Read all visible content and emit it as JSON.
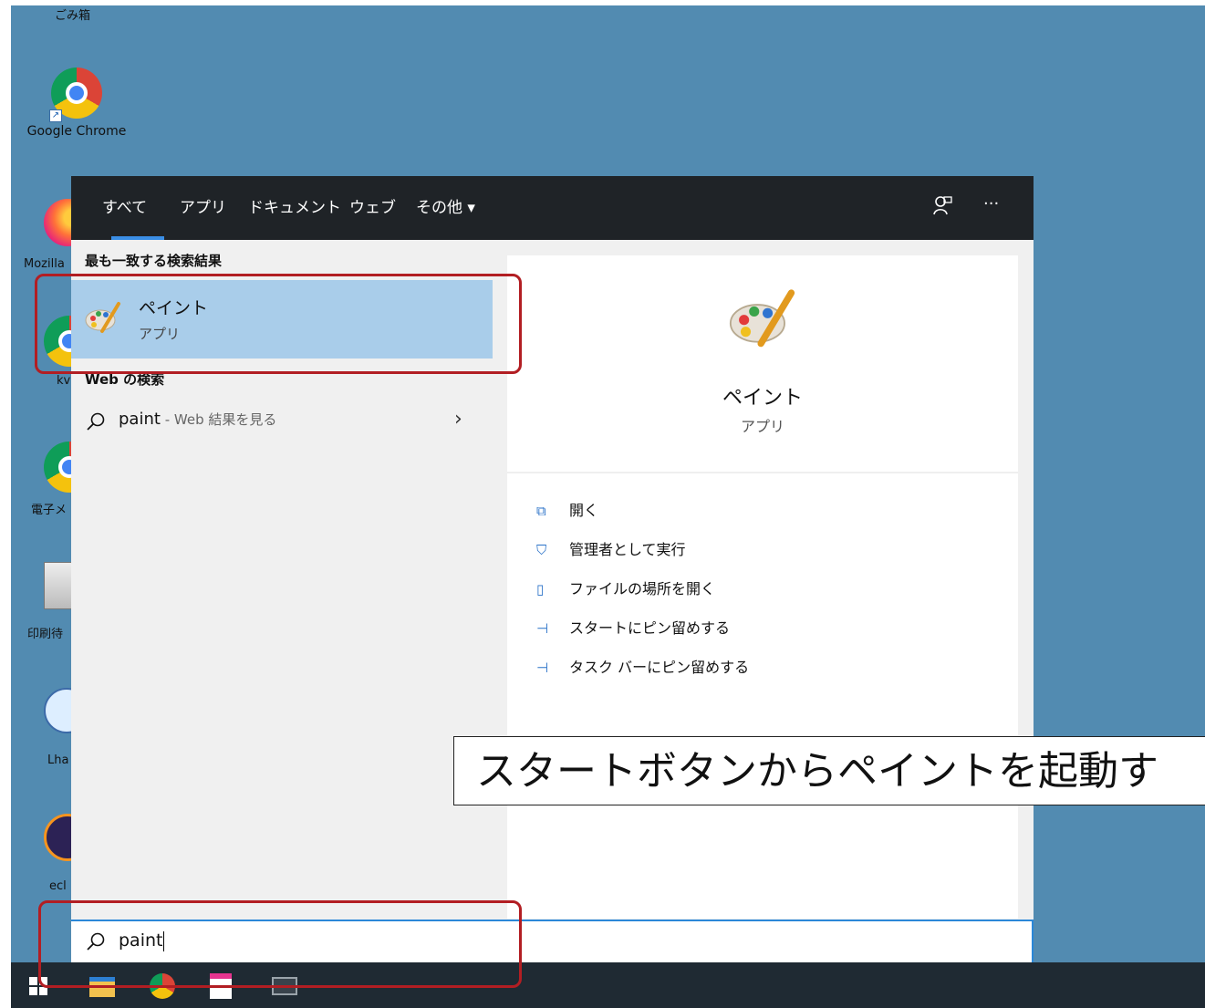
{
  "desktop": {
    "icons": [
      {
        "label": "ごみ箱"
      },
      {
        "label": "Google Chrome"
      },
      {
        "label": "Mozilla"
      },
      {
        "label": "kv"
      },
      {
        "label": "電子メ"
      },
      {
        "label": "印刷待"
      },
      {
        "label": "Lha"
      },
      {
        "label": "ecl"
      }
    ]
  },
  "search_panel": {
    "tabs": [
      {
        "label": "すべて",
        "active": true
      },
      {
        "label": "アプリ"
      },
      {
        "label": "ドキュメント"
      },
      {
        "label": "ウェブ"
      },
      {
        "label": "その他 ▾"
      }
    ],
    "feedback_icon": "person-feedback-icon",
    "more_label": "···",
    "best_match_heading": "最も一致する検索結果",
    "best_match": {
      "name": "ペイント",
      "type": "アプリ",
      "icon": "paint-palette-icon"
    },
    "web_heading": "Web の検索",
    "web_result": {
      "query": "paint",
      "suffix": " - Web 結果を見る"
    },
    "detail": {
      "name": "ペイント",
      "type": "アプリ",
      "actions": [
        {
          "label": "開く",
          "icon": "open-icon"
        },
        {
          "label": "管理者として実行",
          "icon": "shield-run-icon"
        },
        {
          "label": "ファイルの場所を開く",
          "icon": "file-location-icon"
        },
        {
          "label": "スタートにピン留めする",
          "icon": "pin-icon"
        },
        {
          "label": "タスク バーにピン留めする",
          "icon": "pin-icon"
        }
      ]
    },
    "search_value": "paint"
  },
  "caption": "スタートボタンからペイントを起動す",
  "colors": {
    "desktop": "#528bb1",
    "highlight": "#a9cdea",
    "accent": "#2b88d8",
    "annotation": "#b21e23"
  }
}
